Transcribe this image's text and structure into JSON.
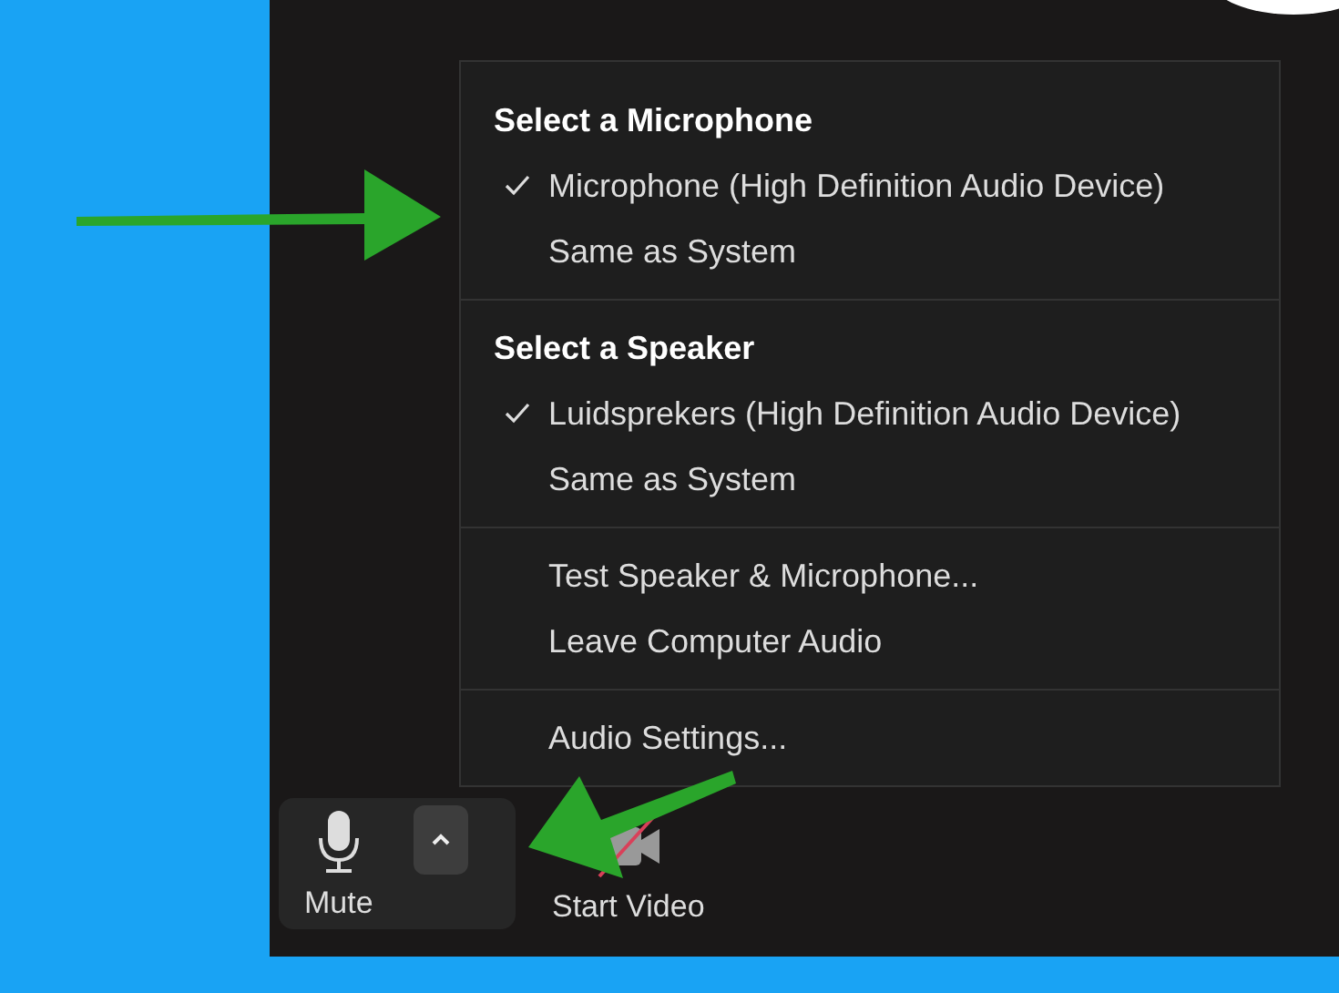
{
  "audio_menu": {
    "sections": [
      {
        "heading": "Select a Microphone",
        "items": [
          {
            "label": "Microphone (High Definition Audio Device)",
            "checked": true
          },
          {
            "label": "Same as System",
            "checked": false
          }
        ]
      },
      {
        "heading": "Select a Speaker",
        "items": [
          {
            "label": "Luidsprekers (High Definition Audio Device)",
            "checked": true
          },
          {
            "label": "Same as System",
            "checked": false
          }
        ]
      },
      {
        "items": [
          {
            "label": "Test Speaker & Microphone...",
            "checked": false
          },
          {
            "label": "Leave Computer Audio",
            "checked": false
          }
        ]
      },
      {
        "items": [
          {
            "label": "Audio Settings...",
            "checked": false
          }
        ]
      }
    ]
  },
  "toolbar": {
    "buttons": [
      {
        "kind": "mute",
        "label": "Mute"
      },
      {
        "kind": "video",
        "label": "Start Video"
      }
    ]
  }
}
